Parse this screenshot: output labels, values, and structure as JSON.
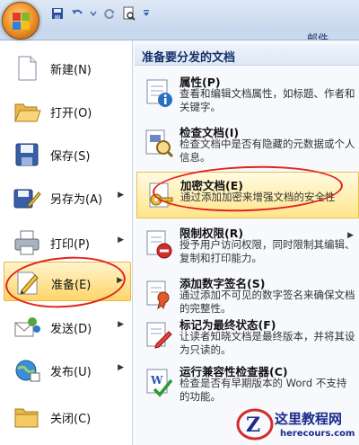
{
  "top": {
    "mail_tab": "邮件"
  },
  "left_menu": [
    {
      "label": "新建(N)",
      "icon": "new-document-icon",
      "submenu": false
    },
    {
      "label": "打开(O)",
      "icon": "open-folder-icon",
      "submenu": false
    },
    {
      "label": "保存(S)",
      "icon": "save-disk-icon",
      "submenu": false
    },
    {
      "label": "另存为(A)",
      "icon": "save-as-icon",
      "submenu": true
    },
    {
      "label": "打印(P)",
      "icon": "printer-icon",
      "submenu": true
    },
    {
      "label": "准备(E)",
      "icon": "prepare-icon",
      "submenu": true,
      "active": true
    },
    {
      "label": "发送(D)",
      "icon": "send-icon",
      "submenu": true
    },
    {
      "label": "发布(U)",
      "icon": "publish-icon",
      "submenu": true
    },
    {
      "label": "关闭(C)",
      "icon": "close-folder-icon",
      "submenu": false
    }
  ],
  "prepare_panel": {
    "title": "准备要分发的文档",
    "items": [
      {
        "title": "属性(P)",
        "desc": "查看和编辑文档属性，如标题、作者和关键字。",
        "icon": "properties-icon"
      },
      {
        "title": "检查文档(I)",
        "desc": "检查文档中是否有隐藏的元数据或个人信息。",
        "icon": "inspect-document-icon"
      },
      {
        "title": "加密文档(E)",
        "desc": "通过添加加密来增强文档的安全性",
        "icon": "encrypt-key-icon",
        "highlighted": true
      },
      {
        "title": "限制权限(R)",
        "desc": "授予用户访问权限，同时限制其编辑、复制和打印能力。",
        "icon": "restrict-permission-icon",
        "submenu": true
      },
      {
        "title": "添加数字签名(S)",
        "desc": "通过添加不可见的数字签名来确保文档的完整性。",
        "icon": "digital-signature-icon"
      },
      {
        "title": "标记为最终状态(F)",
        "desc": "让读者知晓文档是最终版本，并将其设为只读的。",
        "icon": "mark-final-icon"
      },
      {
        "title": "运行兼容性检查器(C)",
        "desc": "检查是否有早期版本的 Word 不支持的功能。",
        "icon": "compatibility-checker-icon"
      }
    ]
  },
  "watermark": {
    "brand": "这里教程网",
    "url": "herecours.com"
  },
  "colors": {
    "highlight": "#ffd56a",
    "circle": "#e2231a",
    "title_text": "#15306a"
  }
}
